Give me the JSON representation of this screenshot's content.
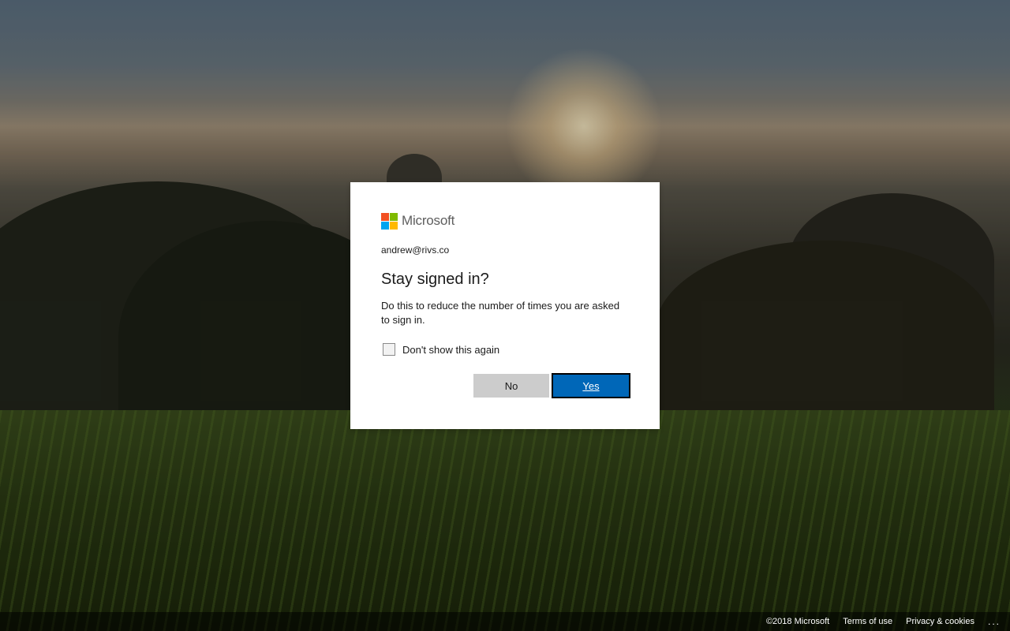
{
  "dialog": {
    "brand_name": "Microsoft",
    "logo_colors": [
      "#f25022",
      "#7fba00",
      "#00a4ef",
      "#ffb900"
    ],
    "account": "andrew@rivs.co",
    "title": "Stay signed in?",
    "description": "Do this to reduce the number of times you are asked to sign in.",
    "checkbox_label": "Don't show this again",
    "checkbox_checked": false,
    "no_label": "No",
    "yes_label": "Yes",
    "accent_color": "#0067b8"
  },
  "footer": {
    "copyright": "©2018 Microsoft",
    "terms": "Terms of use",
    "privacy": "Privacy & cookies",
    "more": "..."
  }
}
